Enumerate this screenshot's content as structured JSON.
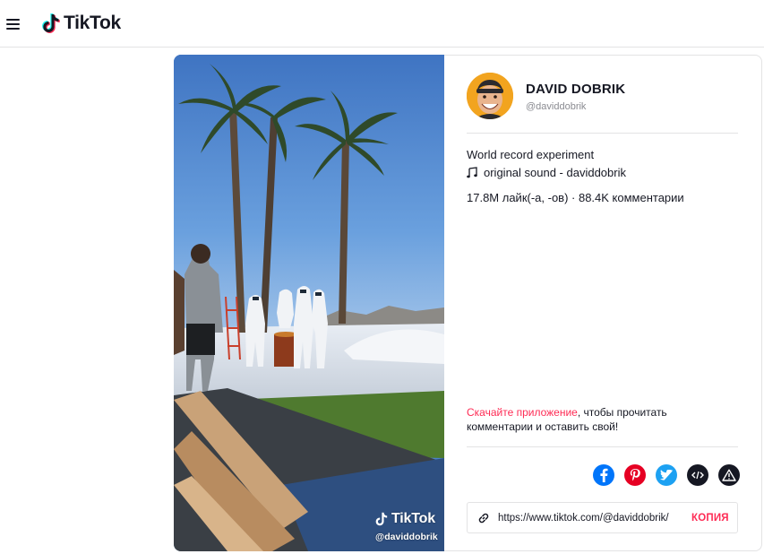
{
  "header": {
    "logo_text": "TikTok"
  },
  "video": {
    "watermark_name": "TikTok",
    "watermark_handle": "@daviddobrik"
  },
  "author": {
    "name": "DAVID DOBRIK",
    "handle": "@daviddobrik"
  },
  "post": {
    "caption": "World record experiment",
    "music": "original sound - daviddobrik",
    "stats": "17.8M лайк(-а, -ов) · 88.4K комментарии"
  },
  "cta": {
    "link_text": "Скачайте приложение",
    "rest_text": ", чтобы прочитать комментарии и оставить свой!"
  },
  "share": {
    "icons": [
      "facebook-icon",
      "pinterest-icon",
      "twitter-icon",
      "embed-icon",
      "report-icon"
    ],
    "colors": {
      "facebook": "#0075fa",
      "pinterest": "#e60023",
      "twitter": "#1da1f2",
      "embed": "#161823",
      "report": "#161823"
    }
  },
  "copy_link": {
    "url": "https://www.tiktok.com/@daviddobrik/",
    "button": "КОПИЯ"
  },
  "colors": {
    "accent": "#fe2c55",
    "text": "#161823",
    "muted": "#8a8b91"
  }
}
